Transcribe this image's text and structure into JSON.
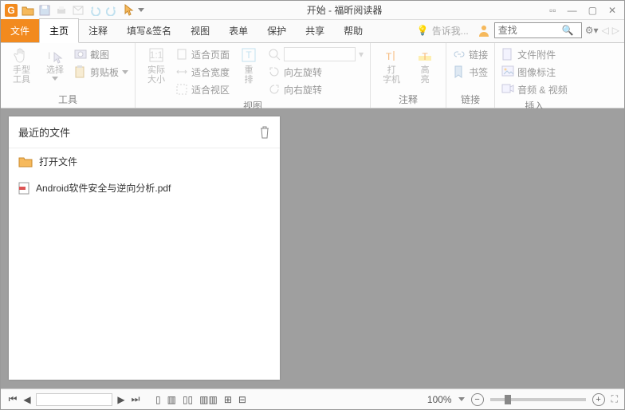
{
  "window": {
    "title": "开始 - 福昕阅读器"
  },
  "tabs": {
    "file": "文件",
    "home": "主页",
    "comment": "注释",
    "fill": "填写&签名",
    "view": "视图",
    "form": "表单",
    "protect": "保护",
    "share": "共享",
    "help": "帮助",
    "tellme": "告诉我..."
  },
  "search": {
    "placeholder": "查找"
  },
  "ribbon": {
    "tools": {
      "hand": "手型\n工具",
      "select": "选择",
      "snapshot": "截图",
      "clipboard": "剪贴板",
      "label": "工具"
    },
    "viewg": {
      "actual": "实际\n大小",
      "fitpage": "适合页面",
      "fitwidth": "适合宽度",
      "fitvisible": "适合视区",
      "reflow": "重\n排",
      "label": "视图"
    },
    "rotate": {
      "left": "向左旋转",
      "right": "向右旋转"
    },
    "annot": {
      "typewriter": "打\n字机",
      "highlight": "高\n亮",
      "label": "注释"
    },
    "link": {
      "link": "链接",
      "bookmark": "书签",
      "label": "链接"
    },
    "insert": {
      "attach": "文件附件",
      "imgstamp": "图像标注",
      "av": "音频 & 视频",
      "label": "插入"
    }
  },
  "panel": {
    "title": "最近的文件",
    "open": "打开文件",
    "file1": "Android软件安全与逆向分析.pdf"
  },
  "status": {
    "zoom": "100%"
  }
}
